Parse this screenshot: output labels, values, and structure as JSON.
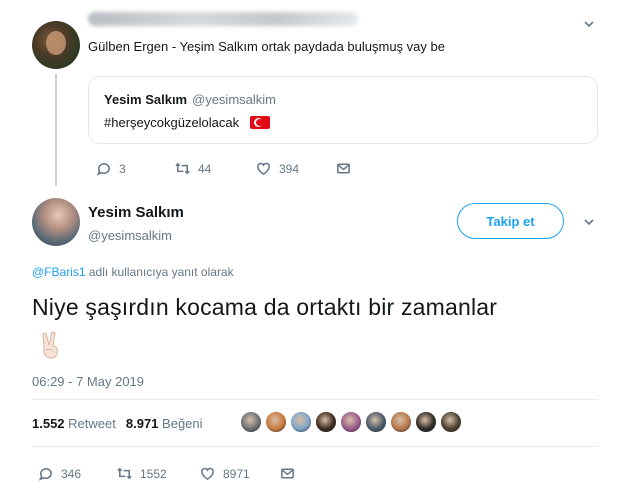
{
  "parent_tweet": {
    "text": "Gülben Ergen - Yeşim Salkım ortak paydada buluşmuş vay be",
    "quote": {
      "name": "Yesim Salkım",
      "handle": "@yesimsalkim",
      "text": "#herşeycokgüzelolacak"
    },
    "actions": {
      "replies": "3",
      "retweets": "44",
      "likes": "394"
    }
  },
  "tweet": {
    "name": "Yesim Salkım",
    "handle": "@yesimsalkim",
    "follow_label": "Takip et",
    "reply_mention": "@FBaris1",
    "reply_suffix": " adlı kullanıcıya yanıt olarak",
    "text": "Niye şaşırdın kocama da ortaktı bir zamanlar",
    "emoji": "✌🏻",
    "timestamp": "06:29 - 7 May 2019",
    "retweet_count": "1.552",
    "retweet_label": "Retweet",
    "like_count": "8.971",
    "like_label": "Beğeni",
    "liker_colors": [
      "#6b6f74",
      "#c87a3c",
      "#7fa6c8",
      "#3a2a1f",
      "#9a5b8c",
      "#4c5a6b",
      "#b6784a",
      "#2e2a26",
      "#4a4030"
    ],
    "actions": {
      "replies": "346",
      "retweets": "1552",
      "likes": "8971"
    }
  }
}
